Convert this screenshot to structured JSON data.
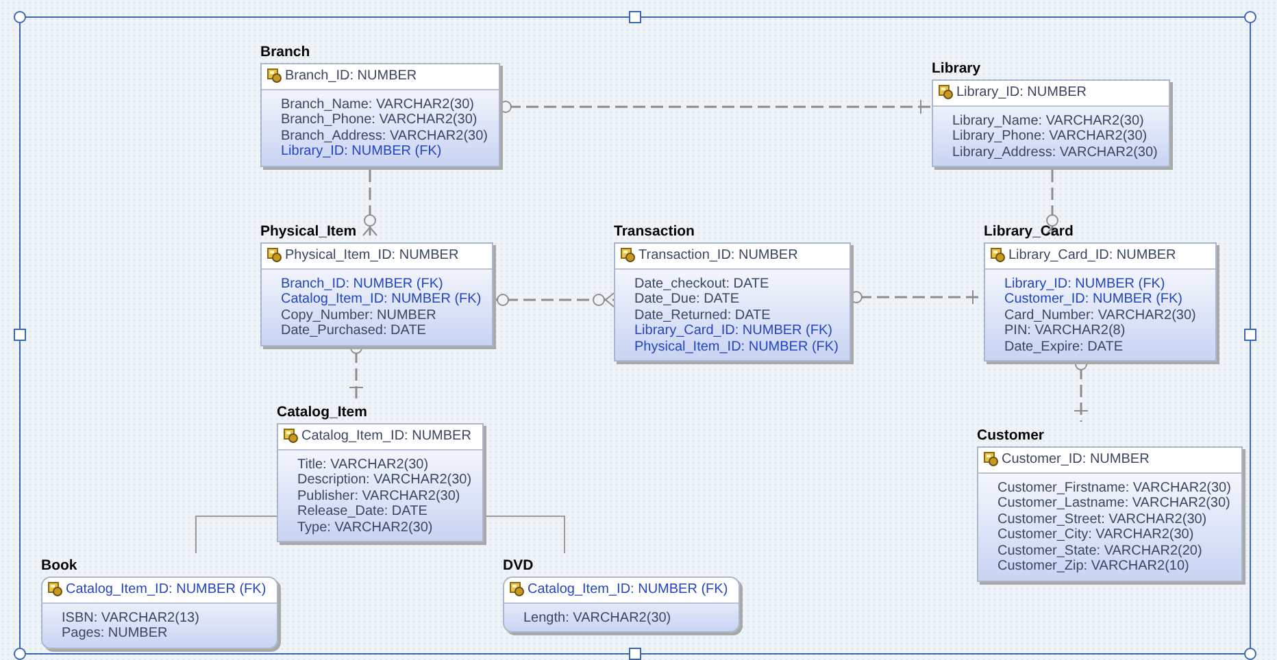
{
  "entities": [
    {
      "name": "Branch",
      "kind": "independent",
      "primary_key": {
        "text": "Branch_ID: NUMBER",
        "fk": false
      },
      "attributes": [
        {
          "text": "Branch_Name: VARCHAR2(30)",
          "fk": false
        },
        {
          "text": "Branch_Phone: VARCHAR2(30)",
          "fk": false
        },
        {
          "text": "Branch_Address: VARCHAR2(30)",
          "fk": false
        },
        {
          "text": "Library_ID: NUMBER (FK)",
          "fk": true
        }
      ]
    },
    {
      "name": "Library",
      "kind": "independent",
      "primary_key": {
        "text": "Library_ID: NUMBER",
        "fk": false
      },
      "attributes": [
        {
          "text": "Library_Name: VARCHAR2(30)",
          "fk": false
        },
        {
          "text": "Library_Phone: VARCHAR2(30)",
          "fk": false
        },
        {
          "text": "Library_Address: VARCHAR2(30)",
          "fk": false
        }
      ]
    },
    {
      "name": "Physical_Item",
      "kind": "independent",
      "primary_key": {
        "text": "Physical_Item_ID: NUMBER",
        "fk": false
      },
      "attributes": [
        {
          "text": "Branch_ID: NUMBER (FK)",
          "fk": true
        },
        {
          "text": "Catalog_Item_ID: NUMBER (FK)",
          "fk": true
        },
        {
          "text": "Copy_Number: NUMBER",
          "fk": false
        },
        {
          "text": "Date_Purchased: DATE",
          "fk": false
        }
      ]
    },
    {
      "name": "Transaction",
      "kind": "independent",
      "primary_key": {
        "text": "Transaction_ID: NUMBER",
        "fk": false
      },
      "attributes": [
        {
          "text": "Date_checkout: DATE",
          "fk": false
        },
        {
          "text": "Date_Due: DATE",
          "fk": false
        },
        {
          "text": "Date_Returned: DATE",
          "fk": false
        },
        {
          "text": "Library_Card_ID: NUMBER (FK)",
          "fk": true
        },
        {
          "text": "Physical_Item_ID: NUMBER (FK)",
          "fk": true
        }
      ]
    },
    {
      "name": "Library_Card",
      "kind": "independent",
      "primary_key": {
        "text": "Library_Card_ID: NUMBER",
        "fk": false
      },
      "attributes": [
        {
          "text": "Library_ID: NUMBER (FK)",
          "fk": true
        },
        {
          "text": "Customer_ID: NUMBER (FK)",
          "fk": true
        },
        {
          "text": "Card_Number: VARCHAR2(30)",
          "fk": false
        },
        {
          "text": "PIN: VARCHAR2(8)",
          "fk": false
        },
        {
          "text": "Date_Expire: DATE",
          "fk": false
        }
      ]
    },
    {
      "name": "Catalog_Item",
      "kind": "independent",
      "primary_key": {
        "text": "Catalog_Item_ID: NUMBER",
        "fk": false
      },
      "attributes": [
        {
          "text": "Title: VARCHAR2(30)",
          "fk": false
        },
        {
          "text": "Description: VARCHAR2(30)",
          "fk": false
        },
        {
          "text": "Publisher: VARCHAR2(30)",
          "fk": false
        },
        {
          "text": "Release_Date: DATE",
          "fk": false
        },
        {
          "text": "Type: VARCHAR2(30)",
          "fk": false
        }
      ]
    },
    {
      "name": "Customer",
      "kind": "independent",
      "primary_key": {
        "text": "Customer_ID: NUMBER",
        "fk": false
      },
      "attributes": [
        {
          "text": "Customer_Firstname: VARCHAR2(30)",
          "fk": false
        },
        {
          "text": "Customer_Lastname: VARCHAR2(30)",
          "fk": false
        },
        {
          "text": "Customer_Street: VARCHAR2(30)",
          "fk": false
        },
        {
          "text": "Customer_City: VARCHAR2(30)",
          "fk": false
        },
        {
          "text": "Customer_State: VARCHAR2(20)",
          "fk": false
        },
        {
          "text": "Customer_Zip: VARCHAR2(10)",
          "fk": false
        }
      ]
    },
    {
      "name": "Book",
      "kind": "dependent",
      "primary_key": {
        "text": "Catalog_Item_ID: NUMBER (FK)",
        "fk": true
      },
      "attributes": [
        {
          "text": "ISBN: VARCHAR2(13)",
          "fk": false
        },
        {
          "text": "Pages: NUMBER",
          "fk": false
        }
      ]
    },
    {
      "name": "DVD",
      "kind": "dependent",
      "primary_key": {
        "text": "Catalog_Item_ID: NUMBER (FK)",
        "fk": true
      },
      "attributes": [
        {
          "text": "Length: VARCHAR2(30)",
          "fk": false
        }
      ]
    }
  ]
}
